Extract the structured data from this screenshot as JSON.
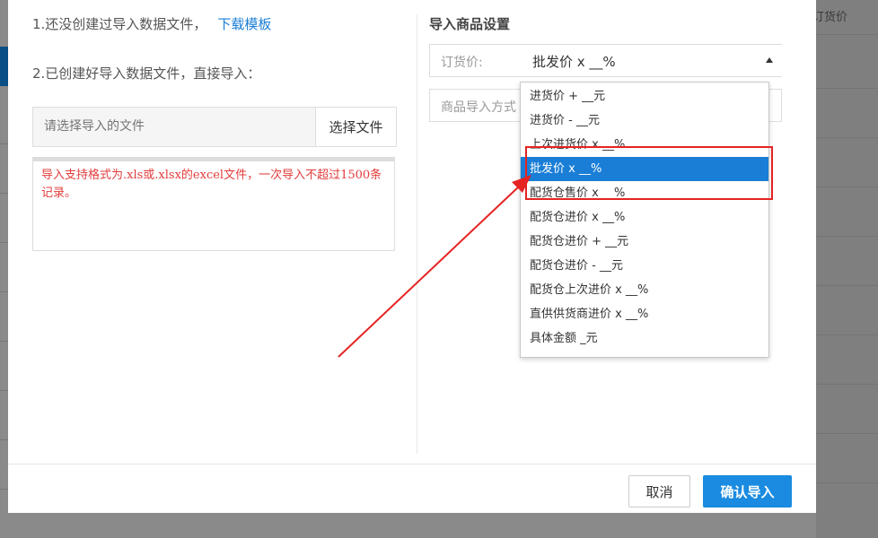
{
  "background": {
    "header_text": "订货价"
  },
  "left_panel": {
    "step1_text": "1.还没创建过导入数据文件，",
    "download_link": "下载模板",
    "step2_text": "2.已创建好导入数据文件，直接导入：",
    "file_placeholder": "请选择导入的文件",
    "choose_file_label": "选择文件",
    "notice_text": "导入支持格式为.xls或.xlsx的excel文件，一次导入不超过1500条记录。"
  },
  "right_panel": {
    "title": "导入商品设置",
    "order_price_label": "订货价:",
    "selected_value": "批发价 x __%",
    "import_method_label": "商品导入方式",
    "options": [
      {
        "label": "进货价 + __元",
        "selected": false
      },
      {
        "label": "进货价 - __元",
        "selected": false
      },
      {
        "label": "上次进货价 x __%",
        "selected": false
      },
      {
        "label": "批发价 x __%",
        "selected": true
      },
      {
        "label": "配货仓售价 x __%",
        "selected": false
      },
      {
        "label": "配货仓进价 x __%",
        "selected": false
      },
      {
        "label": "配货仓进价 + __元",
        "selected": false
      },
      {
        "label": "配货仓进价 - __元",
        "selected": false
      },
      {
        "label": "配货仓上次进价 x __%",
        "selected": false
      },
      {
        "label": "直供供货商进价 x __%",
        "selected": false
      },
      {
        "label": "具体金额 _元",
        "selected": false
      }
    ]
  },
  "footer": {
    "cancel_label": "取消",
    "confirm_label": "确认导入"
  },
  "colors": {
    "accent": "#1a7ed6",
    "confirm_button": "#1a8be0",
    "annotation_red": "#e52323",
    "notice_red": "#e33b3b"
  }
}
